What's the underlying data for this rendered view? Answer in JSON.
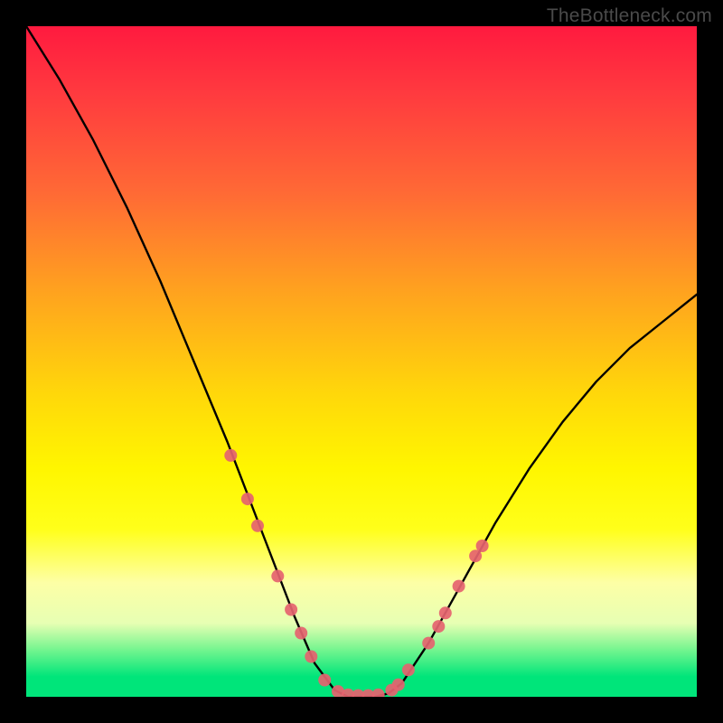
{
  "watermark": "TheBottleneck.com",
  "chart_data": {
    "type": "line",
    "title": "",
    "xlabel": "",
    "ylabel": "",
    "xlim": [
      0,
      100
    ],
    "ylim": [
      0,
      100
    ],
    "background_gradient": {
      "orientation": "vertical",
      "stops": [
        {
          "pos": 0,
          "color": "#ff1a3f"
        },
        {
          "pos": 25,
          "color": "#ff6a35"
        },
        {
          "pos": 55,
          "color": "#ffd80a"
        },
        {
          "pos": 80,
          "color": "#ffff66"
        },
        {
          "pos": 93,
          "color": "#74f58f"
        },
        {
          "pos": 100,
          "color": "#00e57a"
        }
      ]
    },
    "series": [
      {
        "name": "bottleneck-curve",
        "color": "#000000",
        "x": [
          0,
          5,
          10,
          15,
          20,
          25,
          30,
          35,
          40,
          43,
          46,
          48,
          50,
          52,
          54,
          56,
          60,
          65,
          70,
          75,
          80,
          85,
          90,
          95,
          100
        ],
        "values": [
          100,
          92,
          83,
          73,
          62,
          50,
          38,
          25,
          12,
          5,
          1,
          0,
          0,
          0,
          0.5,
          2,
          8,
          17,
          26,
          34,
          41,
          47,
          52,
          56,
          60
        ]
      }
    ],
    "markers": {
      "name": "highlight-points",
      "color": "#e5636f",
      "radius_px": 7,
      "points_xy": [
        [
          30.5,
          36.0
        ],
        [
          33.0,
          29.5
        ],
        [
          34.5,
          25.5
        ],
        [
          37.5,
          18.0
        ],
        [
          39.5,
          13.0
        ],
        [
          41.0,
          9.5
        ],
        [
          42.5,
          6.0
        ],
        [
          44.5,
          2.5
        ],
        [
          46.5,
          0.8
        ],
        [
          48.0,
          0.3
        ],
        [
          49.5,
          0.2
        ],
        [
          51.0,
          0.2
        ],
        [
          52.5,
          0.3
        ],
        [
          54.5,
          1.0
        ],
        [
          55.5,
          1.8
        ],
        [
          57.0,
          4.0
        ],
        [
          60.0,
          8.0
        ],
        [
          61.5,
          10.5
        ],
        [
          62.5,
          12.5
        ],
        [
          64.5,
          16.5
        ],
        [
          67.0,
          21.0
        ],
        [
          68.0,
          22.5
        ]
      ]
    }
  }
}
